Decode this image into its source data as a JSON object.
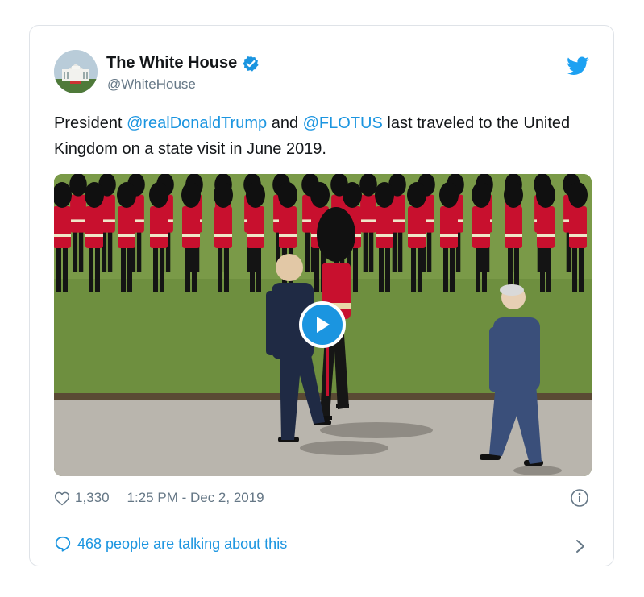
{
  "tweet": {
    "author": {
      "display_name": "The White House",
      "handle": "@WhiteHouse",
      "verified_icon": "verified-badge-icon",
      "avatar_icon": "white-house-avatar"
    },
    "text": {
      "part1": "President ",
      "mention1": "@realDonaldTrump",
      "part2": " and ",
      "mention2": "@FLOTUS",
      "part3": " last traveled to the United Kingdom on a state visit in June 2019."
    },
    "media": {
      "type": "video",
      "play_icon": "play-icon"
    },
    "likes": "1,330",
    "timestamp": "1:25 PM - Dec 2, 2019",
    "talking": "468 people are talking about this"
  },
  "colors": {
    "link": "#1b95e0",
    "text": "#14171a",
    "secondary": "#657786",
    "border": "#dfe3e8",
    "guard_red": "#c8102e",
    "lawn": "#6a8a3c"
  }
}
